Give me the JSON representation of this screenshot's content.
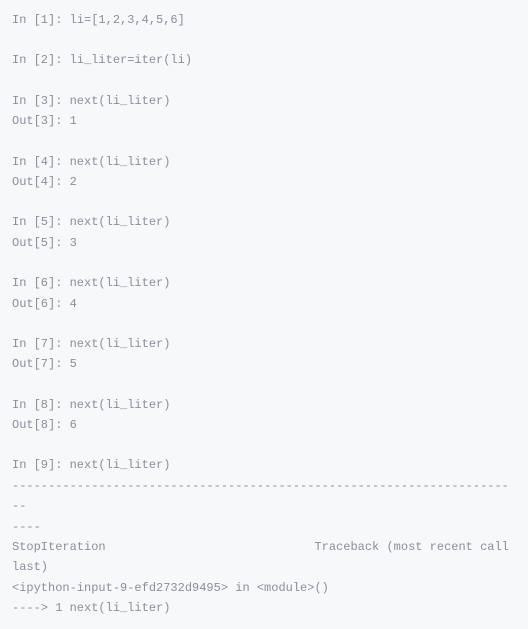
{
  "lines": [
    {
      "type": "in",
      "num": 1,
      "code": "li=[1,2,3,4,5,6]",
      "spacer": true
    },
    {
      "type": "in",
      "num": 2,
      "code": "li_liter=iter(li)",
      "spacer": true
    },
    {
      "type": "in",
      "num": 3,
      "code": "next(li_liter)"
    },
    {
      "type": "out",
      "num": 3,
      "value": "1",
      "spacer": true
    },
    {
      "type": "in",
      "num": 4,
      "code": "next(li_liter)"
    },
    {
      "type": "out",
      "num": 4,
      "value": "2",
      "spacer": true
    },
    {
      "type": "in",
      "num": 5,
      "code": "next(li_liter)"
    },
    {
      "type": "out",
      "num": 5,
      "value": "3",
      "spacer": true
    },
    {
      "type": "in",
      "num": 6,
      "code": "next(li_liter)"
    },
    {
      "type": "out",
      "num": 6,
      "value": "4",
      "spacer": true
    },
    {
      "type": "in",
      "num": 7,
      "code": "next(li_liter)"
    },
    {
      "type": "out",
      "num": 7,
      "value": "5",
      "spacer": true
    },
    {
      "type": "in",
      "num": 8,
      "code": "next(li_liter)"
    },
    {
      "type": "out",
      "num": 8,
      "value": "6",
      "spacer": true
    },
    {
      "type": "in",
      "num": 9,
      "code": "next(li_liter)"
    },
    {
      "type": "raw",
      "text": "-----------------------------------------------------------------------"
    },
    {
      "type": "raw",
      "text": "----"
    },
    {
      "type": "raw",
      "text": "StopIteration                             Traceback (most recent call "
    },
    {
      "type": "raw",
      "text": "last)"
    },
    {
      "type": "raw",
      "text": "<ipython-input-9-efd2732d9495> in <module>()"
    },
    {
      "type": "raw",
      "text": "----> 1 next(li_liter)"
    }
  ]
}
